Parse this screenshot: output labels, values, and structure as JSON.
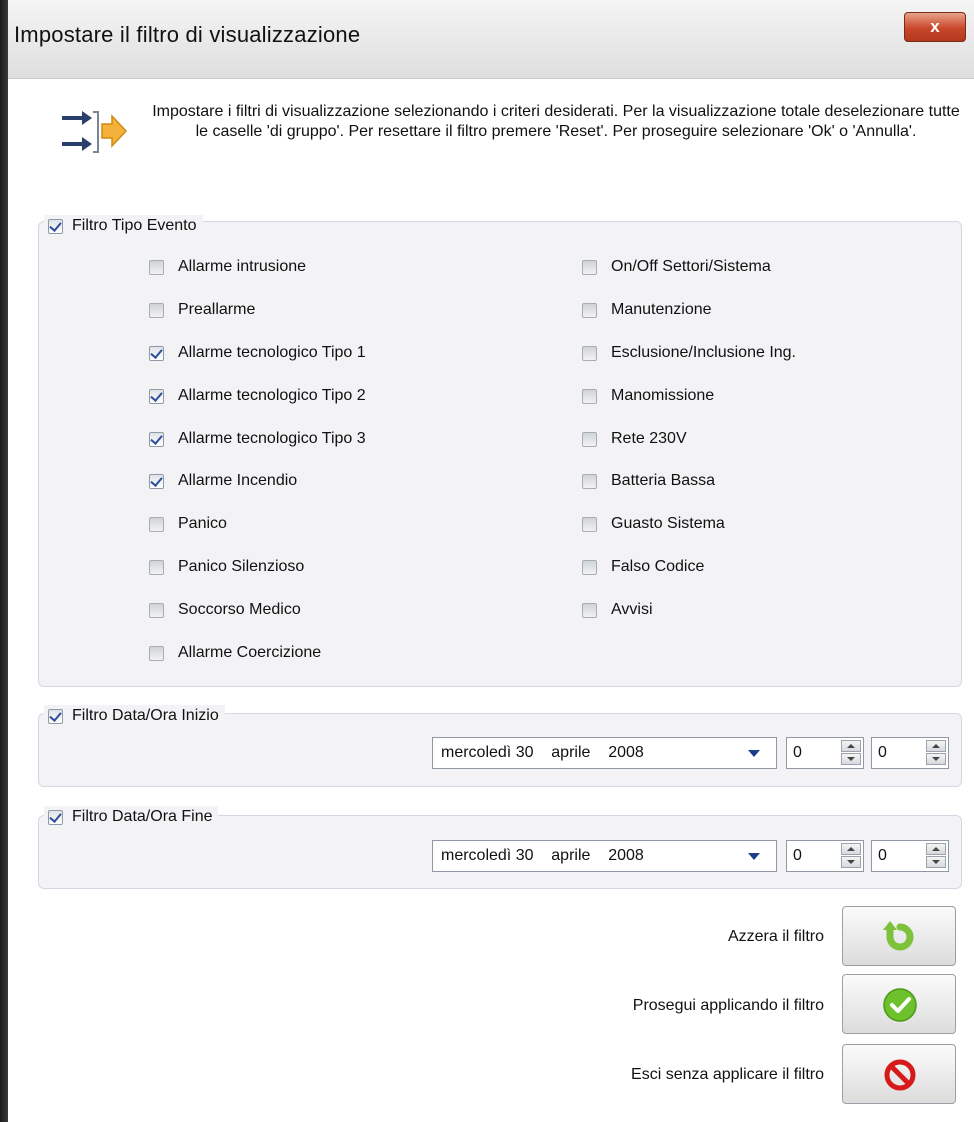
{
  "window": {
    "title": "Impostare il filtro di visualizzazione",
    "close_glyph": "x"
  },
  "info": {
    "icon": "filter-arrows-icon",
    "text": "Impostare i filtri di visualizzazione selezionando i criteri desiderati. Per la visualizzazione totale deselezionare tutte le caselle 'di gruppo'. Per resettare il filtro premere 'Reset'. Per proseguire selezionare 'Ok' o 'Annulla'."
  },
  "tipo_evento": {
    "label": "Filtro Tipo Evento",
    "checked": true,
    "left": [
      {
        "label": "Allarme intrusione",
        "checked": false
      },
      {
        "label": "Preallarme",
        "checked": false
      },
      {
        "label": "Allarme tecnologico Tipo 1",
        "checked": true
      },
      {
        "label": "Allarme tecnologico Tipo 2",
        "checked": true
      },
      {
        "label": "Allarme tecnologico Tipo 3",
        "checked": true
      },
      {
        "label": "Allarme Incendio",
        "checked": true
      },
      {
        "label": "Panico",
        "checked": false
      },
      {
        "label": "Panico Silenzioso",
        "checked": false
      },
      {
        "label": "Soccorso Medico",
        "checked": false
      },
      {
        "label": "Allarme Coercizione",
        "checked": false
      }
    ],
    "right": [
      {
        "label": "On/Off Settori/Sistema",
        "checked": false
      },
      {
        "label": "Manutenzione",
        "checked": false
      },
      {
        "label": "Esclusione/Inclusione Ing.",
        "checked": false
      },
      {
        "label": "Manomissione",
        "checked": false
      },
      {
        "label": "Rete 230V",
        "checked": false
      },
      {
        "label": "Batteria Bassa",
        "checked": false
      },
      {
        "label": "Guasto Sistema",
        "checked": false
      },
      {
        "label": "Falso Codice",
        "checked": false
      },
      {
        "label": "Avvisi",
        "checked": false
      }
    ]
  },
  "inizio": {
    "label": "Filtro Data/Ora Inizio",
    "checked": true,
    "date": "mercoledì 30    aprile    2008",
    "hour": "0",
    "minute": "0"
  },
  "fine": {
    "label": "Filtro Data/Ora Fine",
    "checked": true,
    "date": "mercoledì 30    aprile    2008",
    "hour": "0",
    "minute": "0"
  },
  "actions": {
    "reset_label": "Azzera il filtro",
    "ok_label": "Prosegui applicando il filtro",
    "cancel_label": "Esci senza applicare il filtro"
  },
  "colors": {
    "reset_icon": "#7cc23a",
    "ok_icon": "#6cc12d",
    "cancel_icon": "#d61a1a"
  }
}
